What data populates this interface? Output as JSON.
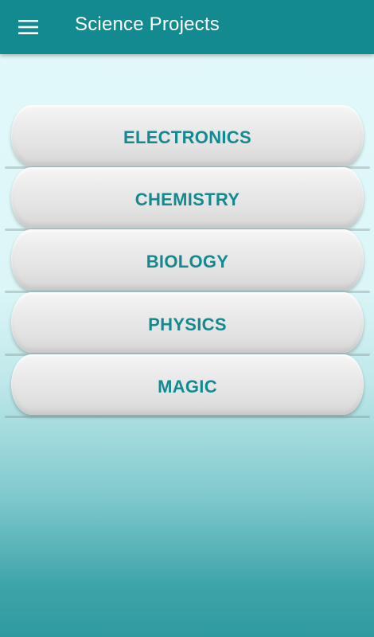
{
  "app_bar": {
    "title": "Science Projects",
    "menu_icon": "hamburger-menu-icon",
    "background_color": "#138a90"
  },
  "categories": [
    {
      "label": "ELECTRONICS"
    },
    {
      "label": "CHEMISTRY"
    },
    {
      "label": "BIOLOGY"
    },
    {
      "label": "PHYSICS"
    },
    {
      "label": "MAGIC"
    }
  ],
  "colors": {
    "accent": "#138a90",
    "button_text": "#138a90",
    "button_face": "#e6e6e6"
  }
}
